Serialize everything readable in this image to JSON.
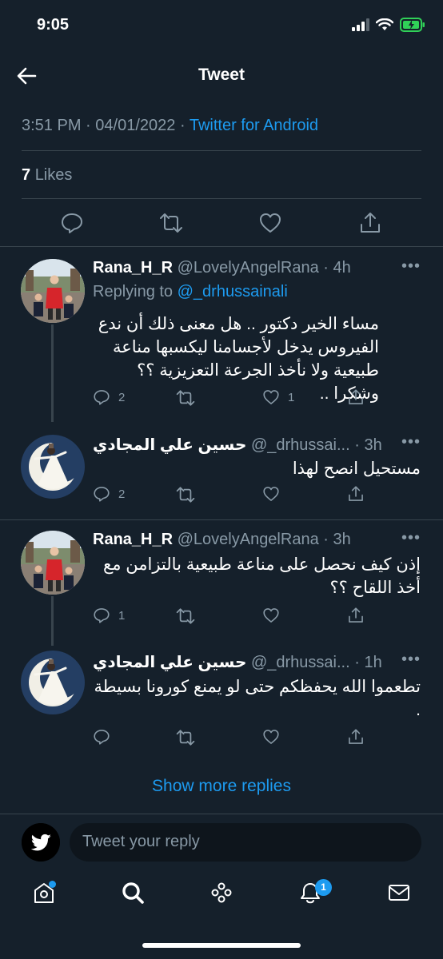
{
  "status_bar": {
    "time": "9:05"
  },
  "header": {
    "title": "Tweet"
  },
  "tweet_meta": {
    "time": "3:51 PM",
    "date": "04/01/2022",
    "separator": "·",
    "source": "Twitter for Android"
  },
  "likes": {
    "count": "7",
    "label": "Likes"
  },
  "replies": [
    {
      "name": "Rana_H_R",
      "handle": "@LovelyAngelRana",
      "time": "· 4h",
      "replying_label": "Replying to",
      "replying_to": "@_drhussainali",
      "text": "مساء الخير دكتور .. هل معنى ذلك أن ندع الفيروس يدخل لأجسامنا ليكسبها مناعة طبيعية ولا نأخذ الجرعة التعزيزية ؟؟ وشكرا ..",
      "reply_count": "2",
      "retweet_count": "",
      "like_count": "1"
    },
    {
      "name": "حسين علي المجادي",
      "handle": "@_drhussai...",
      "time": "· 3h",
      "text": "مستحيل انصح لهذا",
      "reply_count": "2",
      "retweet_count": "",
      "like_count": ""
    },
    {
      "name": "Rana_H_R",
      "handle": "@LovelyAngelRana",
      "time": "· 3h",
      "text": "إذن كيف نحصل على مناعة طبيعية بالتزامن مع أخذ اللقاح ؟؟",
      "reply_count": "1",
      "retweet_count": "",
      "like_count": ""
    },
    {
      "name": "حسين علي المجادي",
      "handle": "@_drhussai...",
      "time": "· 1h",
      "text": "تطعموا الله يحفظكم حتى لو يمنع كورونا بسيطة .",
      "reply_count": "",
      "retweet_count": "",
      "like_count": ""
    }
  ],
  "more_menu": "•••",
  "show_more": "Show more replies",
  "reply_box": {
    "placeholder": "Tweet your reply"
  },
  "nav": {
    "notifications_badge": "1"
  },
  "colors": {
    "background": "#15202b",
    "accent": "#1d9bf0",
    "muted": "#8899a6",
    "divider": "#38444d"
  }
}
